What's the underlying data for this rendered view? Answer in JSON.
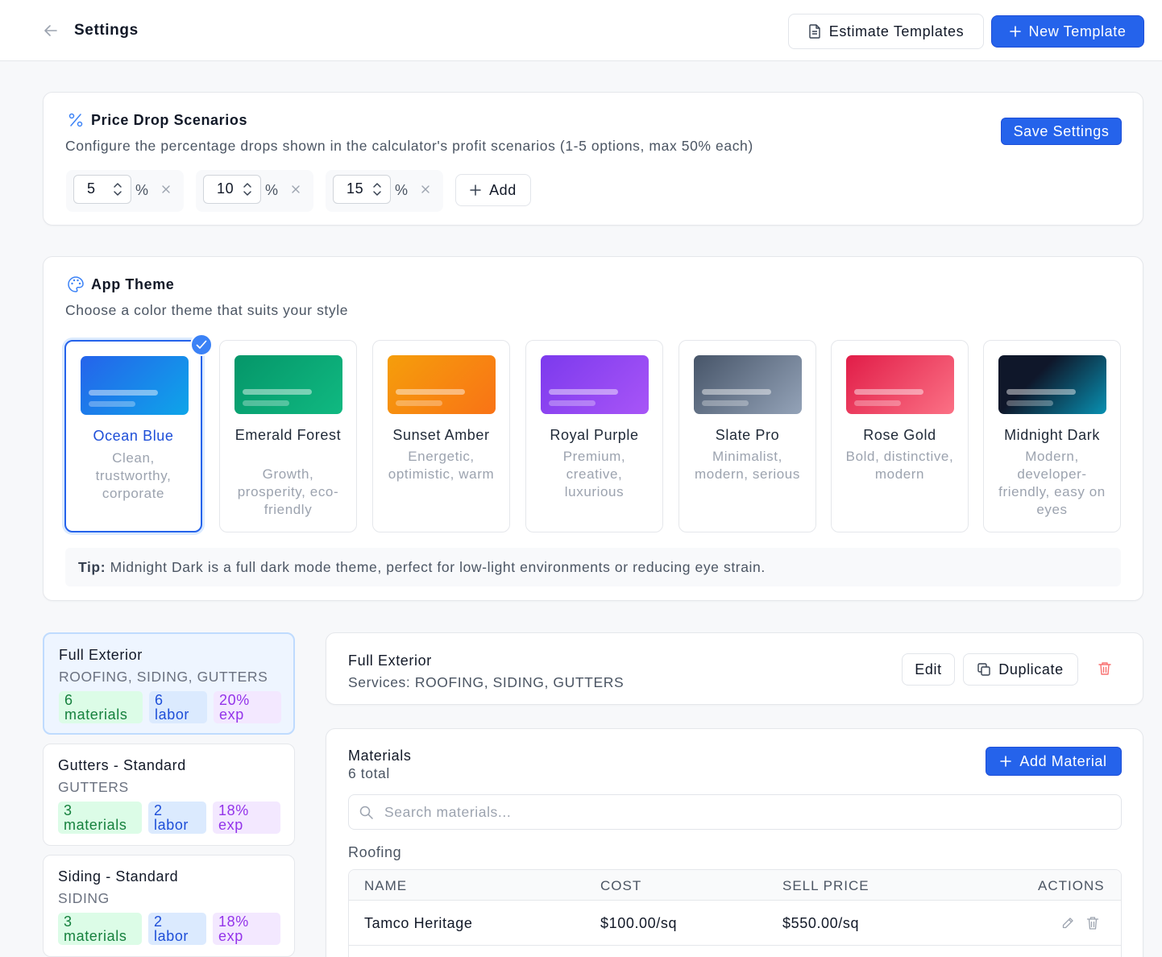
{
  "header": {
    "title": "Settings",
    "estimate_templates_label": "Estimate Templates",
    "new_template_label": "New Template"
  },
  "price_drop": {
    "title": "Price Drop Scenarios",
    "subtitle": "Configure the percentage drops shown in the calculator's profit scenarios (1-5 options, max 50% each)",
    "save_label": "Save Settings",
    "scenarios": [
      {
        "value": "5",
        "unit": "%"
      },
      {
        "value": "10",
        "unit": "%"
      },
      {
        "value": "15",
        "unit": "%"
      }
    ],
    "add_label": "Add"
  },
  "theme": {
    "title": "App Theme",
    "subtitle": "Choose a color theme that suits your style",
    "selected": "Ocean Blue",
    "options": [
      {
        "name": "Ocean Blue",
        "desc": "Clean, trustworthy, corporate",
        "from": "#2563eb",
        "to": "#0ea5e9"
      },
      {
        "name": "Emerald Forest",
        "desc": "Growth, prosperity, eco-friendly",
        "from": "#059669",
        "to": "#10b981"
      },
      {
        "name": "Sunset Amber",
        "desc": "Energetic, optimistic, warm",
        "from": "#f59e0b",
        "to": "#f97316"
      },
      {
        "name": "Royal Purple",
        "desc": "Premium, creative, luxurious",
        "from": "#7c3aed",
        "to": "#a855f7"
      },
      {
        "name": "Slate Pro",
        "desc": "Minimalist, modern, serious",
        "from": "#475569",
        "to": "#94a3b8"
      },
      {
        "name": "Rose Gold",
        "desc": "Bold, distinctive, modern",
        "from": "#e11d48",
        "to": "#fb7185"
      },
      {
        "name": "Midnight Dark",
        "desc": "Modern, developer-friendly, easy on eyes",
        "from": "#0f172a",
        "to": "#0891b2"
      }
    ],
    "tip_label": "Tip:",
    "tip_text": " Midnight Dark is a full dark mode theme, perfect for low-light environments or reducing eye strain."
  },
  "templates": [
    {
      "name": "Full Exterior",
      "services": "ROOFING, SIDING, GUTTERS",
      "materials": "6",
      "materials_unit": "materials",
      "labor": "6",
      "labor_unit": "labor",
      "exp": "20%",
      "exp_unit": "exp"
    },
    {
      "name": "Gutters - Standard",
      "services": "GUTTERS",
      "materials": "3",
      "materials_unit": "materials",
      "labor": "2",
      "labor_unit": "labor",
      "exp": "18%",
      "exp_unit": "exp"
    },
    {
      "name": "Siding - Standard",
      "services": "SIDING",
      "materials": "3",
      "materials_unit": "materials",
      "labor": "2",
      "labor_unit": "labor",
      "exp": "18%",
      "exp_unit": "exp"
    }
  ],
  "detail": {
    "title": "Full Exterior",
    "services": "Services: ROOFING, SIDING, GUTTERS",
    "edit_label": "Edit",
    "duplicate_label": "Duplicate"
  },
  "materials": {
    "title": "Materials",
    "count": "6 total",
    "add_label": "Add Material",
    "search_placeholder": "Search materials...",
    "group": "Roofing",
    "columns": [
      "NAME",
      "COST",
      "SELL PRICE",
      "ACTIONS"
    ],
    "rows": [
      {
        "name": "Tamco Heritage",
        "cost": "$100.00/sq",
        "sell": "$550.00/sq"
      }
    ]
  },
  "colors": {
    "primary": "#2563eb",
    "materials_chip": "#dcfce7",
    "labor_chip": "#dbeafe",
    "exp_chip": "#f3e8ff",
    "danger": "#ef4444"
  }
}
